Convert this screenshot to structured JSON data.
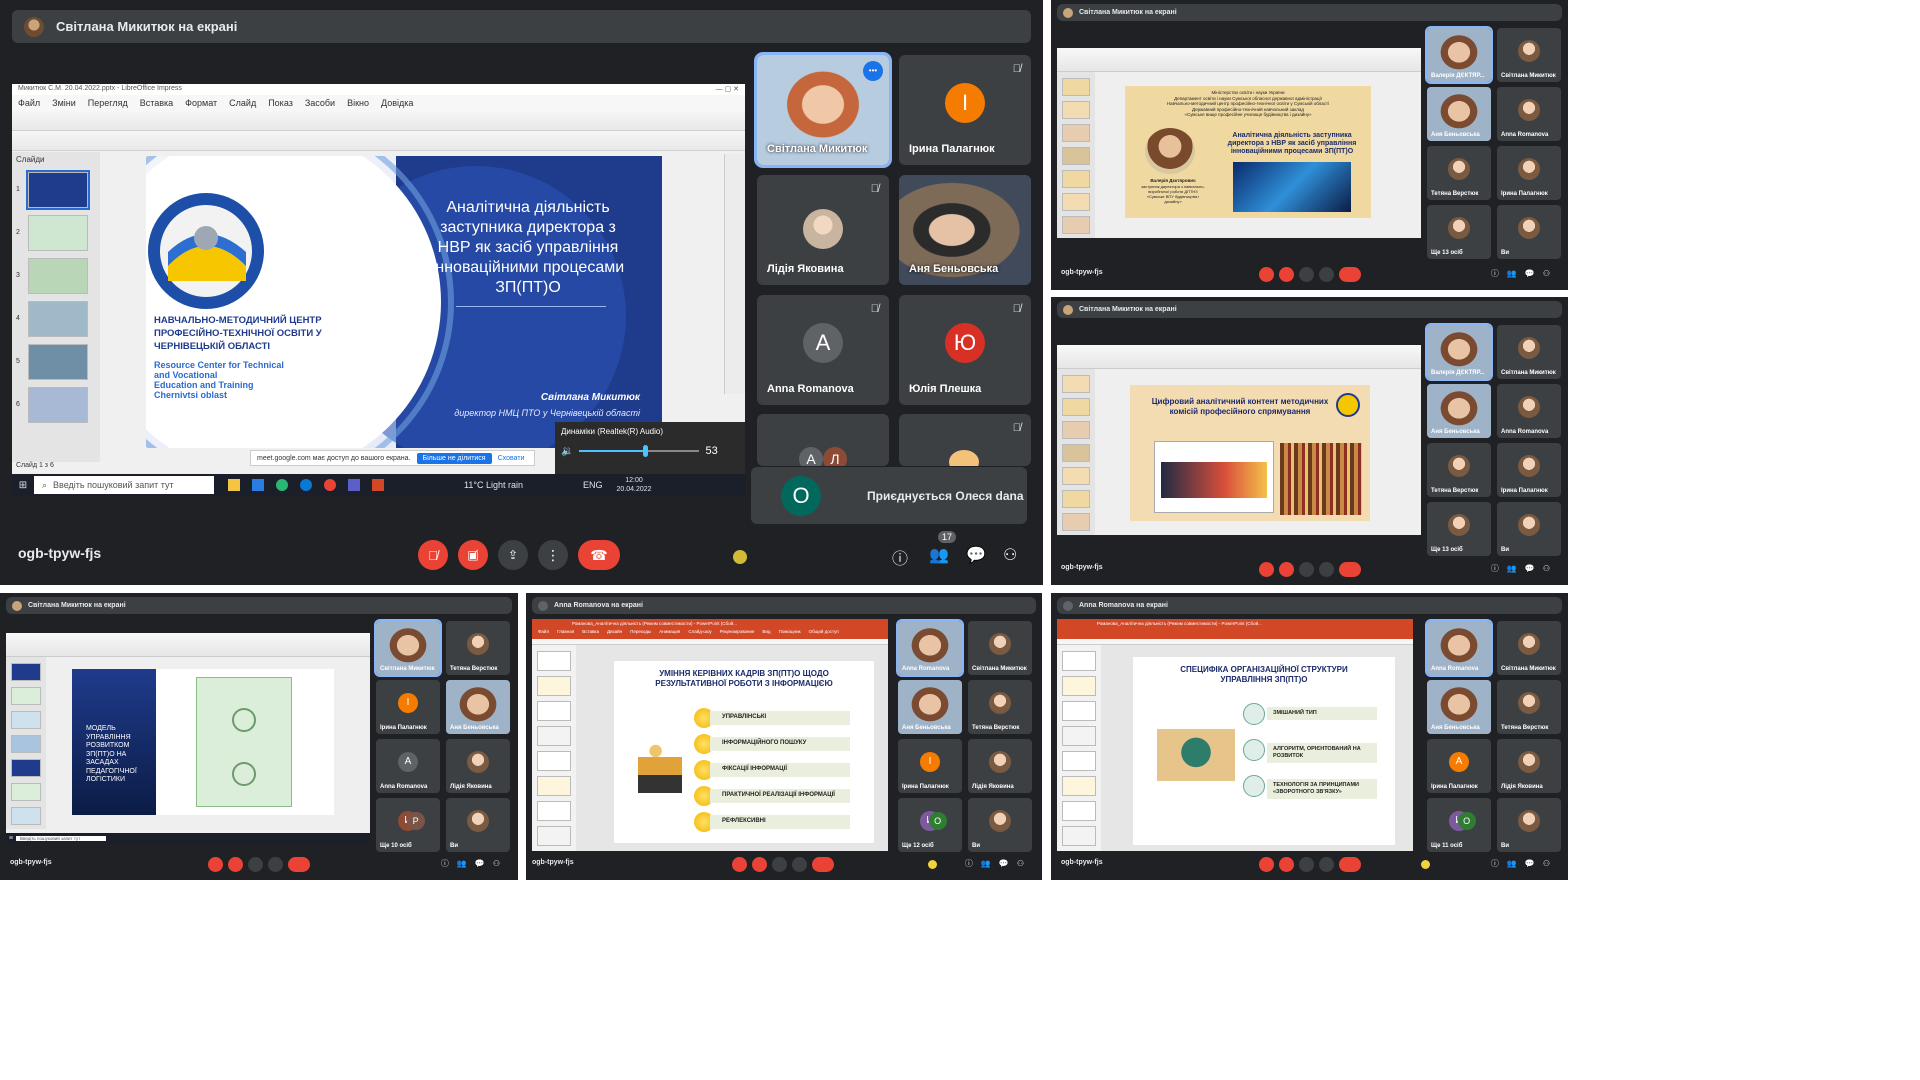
{
  "colors": {
    "meet_bg": "#202124",
    "tile_bg": "#3c4043",
    "red": "#ea4335",
    "orange": "#f57c00",
    "teal": "#00695c",
    "crimson": "#d93025",
    "blue": "#1a73e8",
    "slide_navy": "#1f3b8c",
    "ppt_orange": "#d24726"
  },
  "main": {
    "presenter_bar": "Світлана Микитюк на екрані",
    "meeting_code": "ogb-tpyw-fjs",
    "participants_badge": "17",
    "window_title": "Микитюк С.М. 20.04.2022.pptx - LibreOffice Impress",
    "menu": [
      "Файл",
      "Зміни",
      "Перегляд",
      "Вставка",
      "Формат",
      "Слайд",
      "Показ",
      "Засоби",
      "Вікно",
      "Довідка"
    ],
    "slides_panel_title": "Слайди",
    "slide_numbers": [
      "1",
      "2",
      "3",
      "4",
      "5",
      "6"
    ],
    "slide_status": "Слайд 1 з 6",
    "slide": {
      "title_lines": [
        "Аналітична діяльність",
        "заступника директора з",
        "НВР як засіб управління",
        "інноваційними процесами",
        "ЗП(ПТ)О"
      ],
      "center_ua": [
        "НАВЧАЛЬНО-МЕТОДИЧНИЙ ЦЕНТР",
        "ПРОФЕСІЙНО-ТЕХНІЧНОЇ ОСВІТИ У",
        "ЧЕРНІВЕЦЬКІЙ ОБЛАСТІ"
      ],
      "center_en": [
        "Resource Center for Technical",
        "and Vocational",
        "Education and Training",
        "Chernivtsi oblast"
      ],
      "author": "Світлана Микитюк",
      "author_role": "директор НМЦ ПТО у Чернівецькій області"
    },
    "share_notice": "meet.google.com має доступ до вашого екрана.",
    "share_stop": "Більше не ділитися",
    "share_hide": "Сховати",
    "volume_label": "Динаміки (Realtek(R) Audio)",
    "volume_value": "53",
    "taskbar": {
      "search": "Введіть пошуковий запит тут",
      "weather": "11°C  Light rain",
      "lang": "ENG",
      "time": "12:00",
      "date": "20.04.2022"
    },
    "tiles": [
      {
        "name": "Світлана Микитюк",
        "kind": "photo"
      },
      {
        "name": "Ірина Палагнюк",
        "letter": "І",
        "color": "#f57c00"
      },
      {
        "name": "Лідія Яковина",
        "kind": "photo-small"
      },
      {
        "name": "Аня Беньовська",
        "kind": "photo"
      },
      {
        "name": "Anna Romanova",
        "letter": "A",
        "color": "#5f6368"
      },
      {
        "name": "Юлія Плешка",
        "letter": "Ю",
        "color": "#d93025"
      }
    ],
    "more_tile_letters": [
      "А",
      "Л"
    ],
    "join_toast": {
      "letter": "О",
      "text": "Приєднується Олеся dana"
    }
  },
  "pane_tr": {
    "presenter_bar": "Світлана Микитюк на екрані",
    "meeting_code": "ogb-tpyw-fjs",
    "slide_lines": [
      "Міністерство освіти і науки України",
      "Департамент освіти і науки Сумської обласної державної адміністрації",
      "Навчально-методичний центр професійно-технічної освіти у Сумській області",
      "Державний професійно-технічний навчальний заклад",
      "«Сумське вище професійне училище будівництва і дизайну»"
    ],
    "slide_title": [
      "Аналітична діяльність заступника",
      "директора з НВР як засіб управління",
      "інноваційними процесами ЗП(ПТ)О"
    ],
    "slide_author": "Валерія Дєктярович",
    "slide_author_role": [
      "заступник директора з навчально-",
      "виробничої роботи ДПТНЗ",
      "«Сумське ВПУ будівництва і",
      "дизайну»"
    ],
    "tiles": [
      "Валерія ДЄКТЯР...",
      "Світлана Микитюк",
      "Аня Беньовська",
      "Anna Romanova",
      "Тетяна Верстюк",
      "Ірина Палагнюк",
      "Ще 13 осіб",
      "Ви"
    ]
  },
  "pane_mr": {
    "presenter_bar": "Світлана Микитюк на екрані",
    "meeting_code": "ogb-tpyw-fjs",
    "slide_title": [
      "Цифровий аналітичний контент методичних",
      "комісій професійного спрямування"
    ],
    "tiles": [
      "Валерія ДЄКТЯР...",
      "Світлана Микитюк",
      "Аня Беньовська",
      "Anna Romanova",
      "Тетяна Верстюк",
      "Ірина Палагнюк",
      "Ще 13 осіб",
      "Ви"
    ]
  },
  "pane_bl": {
    "presenter_bar": "Світлана Микитюк на екрані",
    "meeting_code": "ogb-tpyw-fjs",
    "slide_text": [
      "МОДЕЛЬ",
      "УПРАВЛІННЯ",
      "РОЗВИТКОМ",
      "ЗП(ПТ)О НА",
      "ЗАСАДАХ",
      "ПЕДАГОГІЧНОЇ",
      "ЛОГІСТИКИ"
    ],
    "taskbar_search": "Введіть пошуковий запит тут",
    "tiles": [
      "Світлана Микитюк",
      "Тетяна Верстюк",
      "Ірина Палагнюк",
      "Аня Беньовська",
      "Anna Romanova",
      "Лідія Яковина",
      "Ще 10 осіб",
      "Ви"
    ],
    "tile_letters": [
      "І",
      "A",
      "И",
      "Р"
    ]
  },
  "pane_bm": {
    "presenter_bar": "Anna Romanova на екрані",
    "meeting_code": "ogb-tpyw-fjs",
    "window_title": "Романова_Аналітична діяльність (Режим совместимости) - PowerPoint (Сбой...",
    "ribbon": [
      "Файл",
      "Главная",
      "Вставка",
      "Дизайн",
      "Переходы",
      "Анимация",
      "Слайд-шоу",
      "Рецензирование",
      "Вид",
      "Помощник",
      "Общий доступ"
    ],
    "slide_title": [
      "УМІННЯ КЕРІВНИХ КАДРІВ ЗП(ПТ)О ЩОДО",
      "РЕЗУЛЬТАТИВНОЇ РОБОТИ З ІНФОРМАЦІЄЮ"
    ],
    "items": [
      "УПРАВЛІНСЬКІ",
      "ІНФОРМАЦІЙНОГО ПОШУКУ",
      "ФІКСАЦІЇ ІНФОРМАЦІЇ",
      "ПРАКТИЧНОЇ РЕАЛІЗАЦІЇ ІНФОРМАЦІЇ",
      "РЕФЛЕКСИВНІ"
    ],
    "tiles": [
      "Anna Romanova",
      "Світлана Микитюк",
      "Аня Беньовська",
      "Тетяна Верстюк",
      "Ірина Палагнюк",
      "Лідія Яковина",
      "Ще 12 осіб",
      "Ви"
    ],
    "tile_letters": [
      "І",
      "И",
      "О"
    ]
  },
  "pane_br": {
    "presenter_bar": "Anna Romanova на екрані",
    "meeting_code": "ogb-tpyw-fjs",
    "window_title": "Романова_Аналітична діяльність (Режим совместимости) - PowerPoint (Сбой...",
    "slide_title": [
      "СПЕЦИФІКА ОРГАНІЗАЦІЙНОЇ СТРУКТУРИ",
      "УПРАВЛІННЯ ЗП(ПТ)О"
    ],
    "items": [
      "ЗМІШАНИЙ ТИП",
      "АЛГОРИТМ, ОРІЄНТОВАНИЙ НА РОЗВИТОК",
      "ТЕХНОЛОГІЯ ЗА ПРИНЦИПАМИ «ЗВОРОТНОГО ЗВ'ЯЗКУ»"
    ],
    "tiles": [
      "Anna Romanova",
      "Світлана Микитюк",
      "Аня Беньовська",
      "Тетяна Верстюк",
      "Ірина Палагнюк",
      "Лідія Яковина",
      "Ще 11 осіб",
      "Ви"
    ],
    "tile_letters": [
      "A",
      "И",
      "О"
    ]
  }
}
